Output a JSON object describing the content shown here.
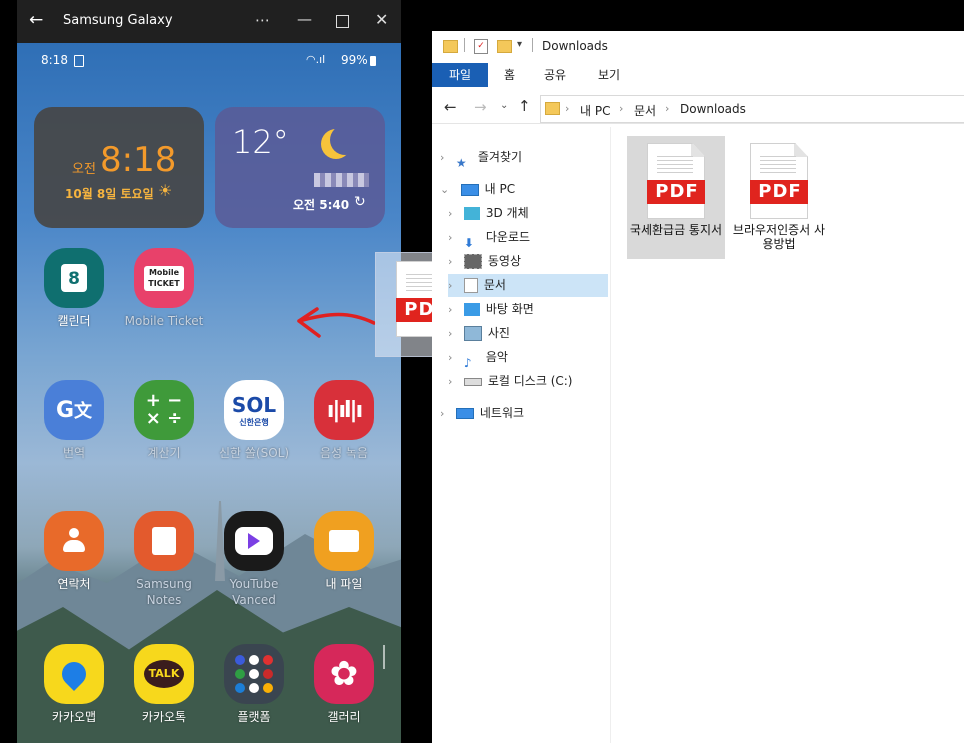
{
  "phone": {
    "window_title": "Samsung Galaxy",
    "status": {
      "time": "8:18",
      "battery": "99%"
    },
    "clock_widget": {
      "ampm": "오전",
      "time": "8:18",
      "date": "10월 8일 토요일"
    },
    "weather_widget": {
      "temp": "12°",
      "updated": "오전 5:40"
    },
    "apps": [
      {
        "label": "캘린더"
      },
      {
        "label": "Mobile Ticket"
      },
      {
        "label": "번역"
      },
      {
        "label": "계산기"
      },
      {
        "label": "신한 쏠(SOL)"
      },
      {
        "label": "음성 녹음"
      },
      {
        "label": "연락처"
      },
      {
        "label": "Samsung Notes"
      },
      {
        "label": "YouTube Vanced"
      },
      {
        "label": "내 파일"
      },
      {
        "label": "카카오맵"
      },
      {
        "label": "카카오톡"
      },
      {
        "label": "플랫폼"
      },
      {
        "label": "갤러리"
      }
    ],
    "calendar_day": "8",
    "sol_text": "SOL",
    "sol_sub": "신한은행",
    "talk_text": "TALK",
    "ticket_text": "Mobile TICKET"
  },
  "drag_ghost": {
    "badge": "PDF"
  },
  "explorer": {
    "title": "Downloads",
    "ribbon_tabs": [
      "파일",
      "홈",
      "공유",
      "보기"
    ],
    "breadcrumb": [
      "내 PC",
      "문서",
      "Downloads"
    ],
    "nav": [
      {
        "label": "즐겨찾기"
      },
      {
        "label": "내 PC"
      },
      {
        "label": "3D 개체"
      },
      {
        "label": "다운로드"
      },
      {
        "label": "동영상"
      },
      {
        "label": "문서"
      },
      {
        "label": "바탕 화면"
      },
      {
        "label": "사진"
      },
      {
        "label": "음악"
      },
      {
        "label": "로컬 디스크 (C:)"
      },
      {
        "label": "네트워크"
      }
    ],
    "files": [
      {
        "badge": "PDF",
        "name": "국세환급금 통지서"
      },
      {
        "badge": "PDF",
        "name": "브라우저인증서 사용방법"
      }
    ]
  },
  "colors": {
    "accent": "#1a5fb4",
    "pdf_red": "#e0241e",
    "arrow": "#e02020",
    "orange_clock": "#f39a2b"
  }
}
